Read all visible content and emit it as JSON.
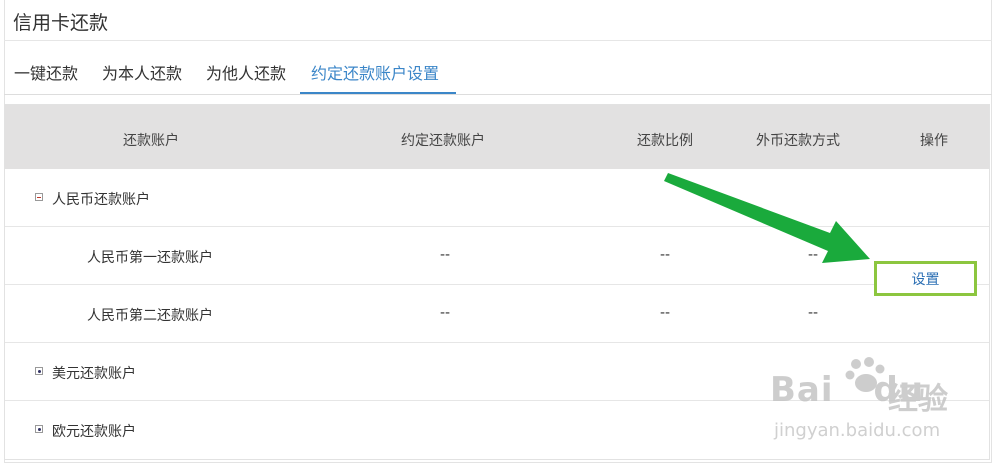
{
  "title": "信用卡还款",
  "tabs": [
    {
      "label": "一键还款"
    },
    {
      "label": "为本人还款"
    },
    {
      "label": "为他人还款"
    },
    {
      "label": "约定还款账户设置",
      "active": true
    }
  ],
  "table": {
    "headers": [
      "还款账户",
      "约定还款账户",
      "还款比例",
      "外币还款方式",
      "操作"
    ],
    "groups": [
      {
        "label": "人民币还款账户",
        "expanded": true,
        "rows": [
          {
            "name": "人民币第一还款账户",
            "account": "--",
            "ratio": "--",
            "foreign": "--",
            "action": "设置"
          },
          {
            "name": "人民币第二还款账户",
            "account": "--",
            "ratio": "--",
            "foreign": "--"
          }
        ]
      },
      {
        "label": "美元还款账户",
        "expanded": false
      },
      {
        "label": "欧元还款账户",
        "expanded": false
      }
    ]
  },
  "watermark": {
    "logo": "Bai",
    "logo2": "du",
    "cn": "经验",
    "url": "jingyan.baidu.com"
  },
  "colors": {
    "accent": "#3b86c8",
    "highlight_box": "#8cc63f",
    "arrow": "#1aaa3c",
    "header_bg": "#e2e1e1"
  }
}
